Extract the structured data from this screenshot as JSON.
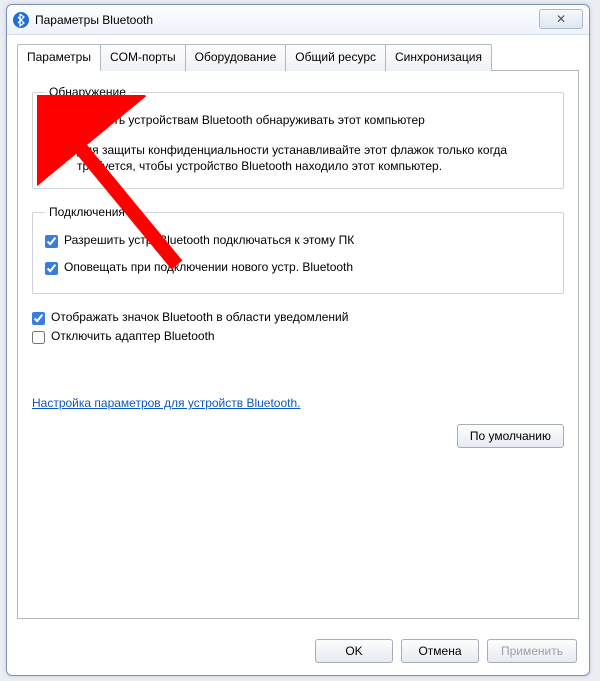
{
  "window": {
    "title": "Параметры Bluetooth"
  },
  "close_glyph": "✕",
  "tabs": {
    "t0": "Параметры",
    "t1": "COM-порты",
    "t2": "Оборудование",
    "t3": "Общий ресурс",
    "t4": "Синхронизация"
  },
  "discovery": {
    "legend": "Обнаружение",
    "allow_label": "Разрешить устройствам Bluetooth обнаруживать этот компьютер",
    "allow_checked": true,
    "warning": "Для защиты конфиденциальности устанавливайте этот флажок только когда требуется, чтобы устройство Bluetooth находило этот компьютер."
  },
  "connections": {
    "legend": "Подключения",
    "allow_connect_label": "Разрешить устр. Bluetooth подключаться к этому ПК",
    "allow_connect_checked": true,
    "notify_label": "Оповещать при подключении нового устр. Bluetooth",
    "notify_checked": true
  },
  "misc": {
    "show_icon_label": "Отображать значок Bluetooth в области уведомлений",
    "show_icon_checked": true,
    "disable_adapter_label": "Отключить адаптер Bluetooth",
    "disable_adapter_checked": false
  },
  "link_text": "Настройка параметров для устройств Bluetooth.",
  "buttons": {
    "defaults": "По умолчанию",
    "ok": "OK",
    "cancel": "Отмена",
    "apply": "Применить"
  }
}
